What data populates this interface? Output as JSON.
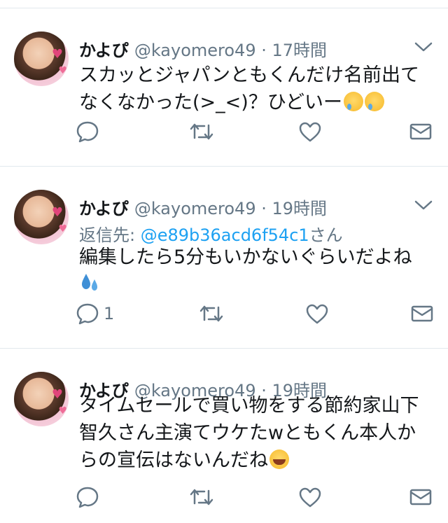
{
  "tweets": [
    {
      "name": "かよぴ",
      "handle": "@kayomero49 · 17時間",
      "reply_to_prefix": "",
      "reply_to_mention": "",
      "reply_to_suffix": "",
      "text_lines": [
        "スカッとジャパンともくんだけ名前出て",
        "なくなかった(>_<)？ひどいー"
      ],
      "emoji": [
        "crying-face",
        "crying-face"
      ],
      "reply_count": ""
    },
    {
      "name": "かよぴ",
      "handle": "@kayomero49 · 19時間",
      "reply_to_prefix": "返信先: ",
      "reply_to_mention": "@e89b36acd6f54c1",
      "reply_to_suffix": "さん",
      "text_lines": [
        "編集したら5分もいかないぐらいだよね"
      ],
      "emoji": [
        "sweat-droplets"
      ],
      "reply_count": "1"
    },
    {
      "name": "かよぴ",
      "handle": "@kayomero49 · 19時間",
      "reply_to_prefix": "",
      "reply_to_mention": "",
      "reply_to_suffix": "",
      "text_lines": [
        "タイムセールで買い物をする節約家山下",
        "智久さん主演てウケたwともくん本人か",
        "らの宣伝はないんだね"
      ],
      "emoji": [
        "tears-of-joy"
      ],
      "reply_count": ""
    }
  ],
  "colors": {
    "secondary": "#657786",
    "link": "#1da1f2",
    "divider": "#e1e8ed"
  }
}
